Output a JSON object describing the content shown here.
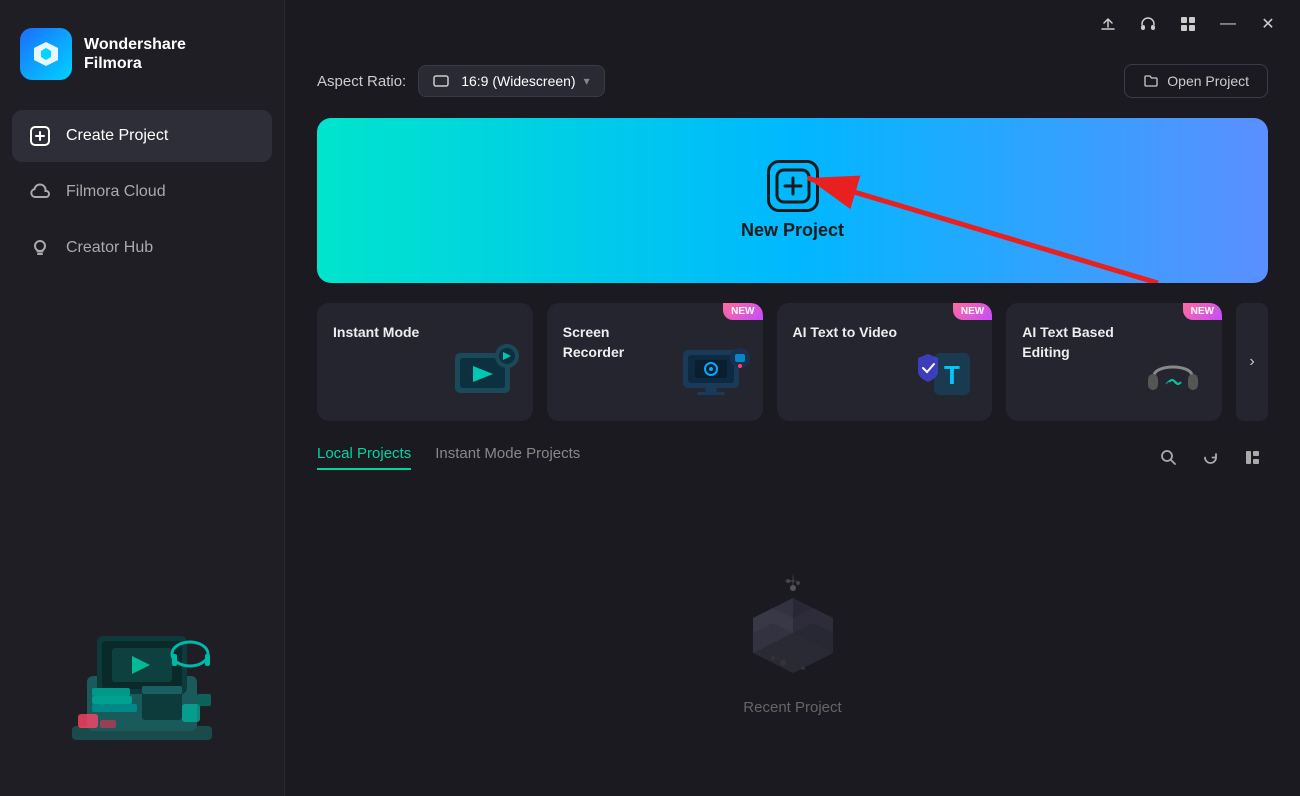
{
  "app": {
    "name": "Wondershare",
    "subtitle": "Filmora",
    "title": "Wondershare Filmora"
  },
  "titlebar": {
    "upload_label": "⬆",
    "headphones_label": "🎧",
    "grid_label": "⊞",
    "minimize_label": "—",
    "close_label": "✕"
  },
  "sidebar": {
    "items": [
      {
        "id": "create-project",
        "label": "Create Project",
        "icon": "plus-square-icon",
        "active": true
      },
      {
        "id": "filmora-cloud",
        "label": "Filmora Cloud",
        "icon": "cloud-icon",
        "active": false
      },
      {
        "id": "creator-hub",
        "label": "Creator Hub",
        "icon": "bulb-icon",
        "active": false
      }
    ]
  },
  "aspect_ratio": {
    "label": "Aspect Ratio:",
    "value": "16:9 (Widescreen)",
    "icon": "monitor-icon"
  },
  "open_project": {
    "label": "Open Project",
    "icon": "folder-icon"
  },
  "new_project": {
    "label": "New Project"
  },
  "feature_cards": [
    {
      "id": "instant-mode",
      "label": "Instant Mode",
      "badge": null
    },
    {
      "id": "screen-recorder",
      "label": "Screen Recorder",
      "badge": "NEW"
    },
    {
      "id": "ai-text-to-video",
      "label": "AI Text to Video",
      "badge": "NEW"
    },
    {
      "id": "ai-text-based-editing",
      "label": "AI Text Based Editing",
      "badge": "NEW"
    }
  ],
  "scroll_next": ">",
  "tabs": [
    {
      "id": "local-projects",
      "label": "Local Projects",
      "active": true
    },
    {
      "id": "instant-mode-projects",
      "label": "Instant Mode Projects",
      "active": false
    }
  ],
  "tab_actions": {
    "search": "🔍",
    "refresh": "↻",
    "grid_view": "⊞"
  },
  "empty_state": {
    "label": "Recent Project"
  },
  "colors": {
    "accent_green": "#00d4a0",
    "sidebar_bg": "#1e1e24",
    "card_bg": "#252530",
    "new_badge": "#c44dff"
  }
}
